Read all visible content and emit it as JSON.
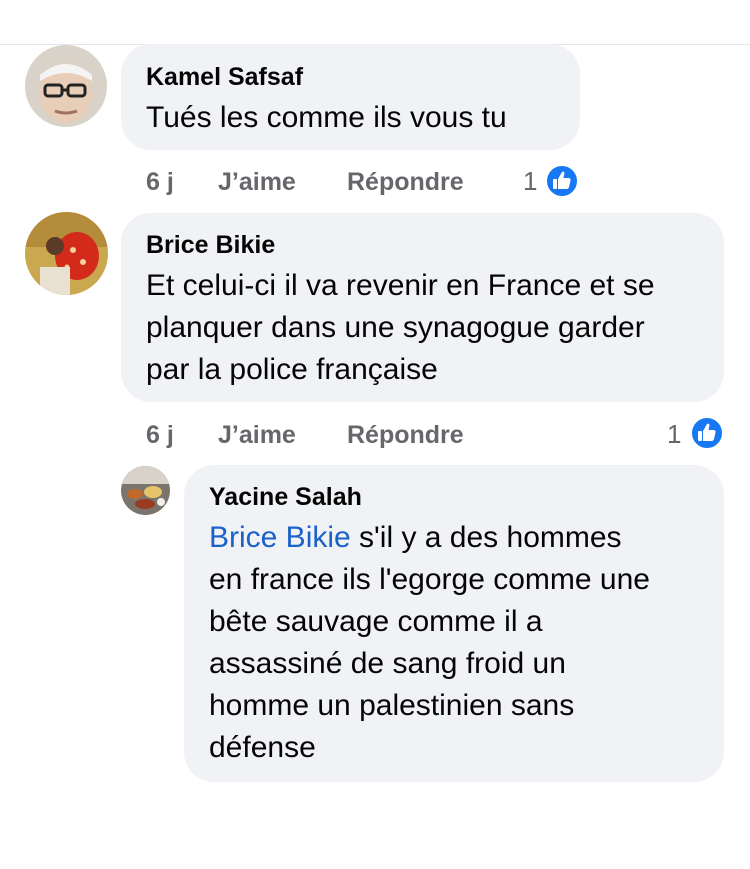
{
  "comments": [
    {
      "author": "Kamel Safsaf",
      "text": "Tués les comme ils vous tu",
      "time": "6 j",
      "like_label": "J’aime",
      "reply_label": "Répondre",
      "like_count": "1"
    },
    {
      "author": "Brice Bikie",
      "text_lines": [
        "Et celui-ci il va revenir en France et se",
        "planquer dans une synagogue garder",
        "par la police française"
      ],
      "time": "6 j",
      "like_label": "J’aime",
      "reply_label": "Répondre",
      "like_count": "1"
    }
  ],
  "reply": {
    "author": "Yacine Salah",
    "mention": "Brice Bikie",
    "first_line_rest": " s'il y a des hommes",
    "text_lines": [
      "en france ils l'egorge comme une",
      "bête sauvage comme il a",
      "assassiné de sang froid un",
      "homme un palestinien sans",
      "défense"
    ]
  },
  "colors": {
    "bubble": "#f0f2f5",
    "name": "#050505",
    "meta": "#65676b",
    "mention": "#1a62c9",
    "like_blue": "#1877f2"
  },
  "icons": [
    "thumbs-up-icon"
  ]
}
